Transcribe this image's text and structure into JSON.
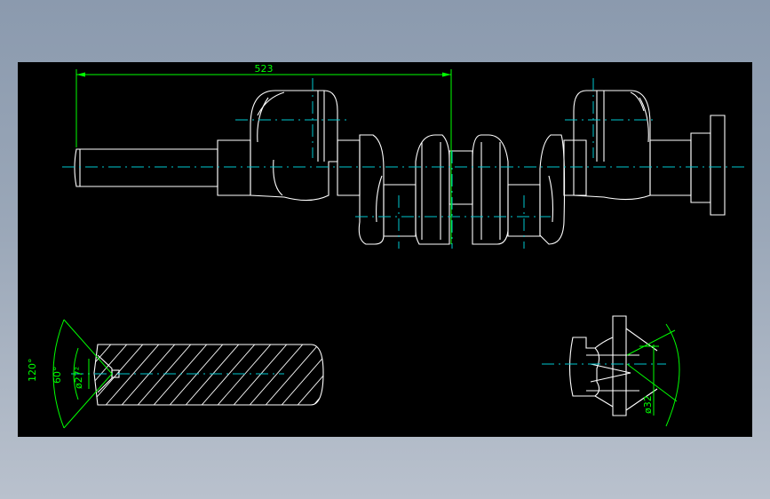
{
  "dimensions": {
    "overall_length": "523",
    "cone_angle_outer": "120°",
    "cone_angle_inner": "60°",
    "hole_diameter": "ø27²",
    "flange_diameter": "ø32"
  },
  "colors": {
    "background": "#000000",
    "geometry": "#ffffff",
    "centerline": "#00c8d0",
    "dimension": "#00ff00",
    "frame": "#8b9aae"
  }
}
